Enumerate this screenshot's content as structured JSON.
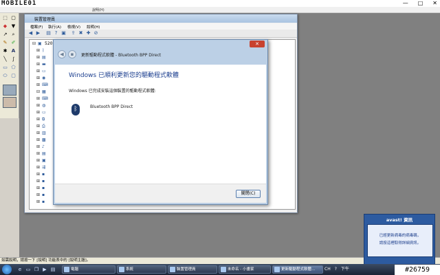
{
  "paint": {
    "title": "未命名 - 小畫家",
    "logo_text": "MOBILE01",
    "help_menu": "說明(H)",
    "controls": {
      "minimize": "—",
      "maximize": "□",
      "close": "✕"
    },
    "status_text": "如需說明，請按一下 [說明] 功能表中的 [說明主題]。"
  },
  "device_manager": {
    "title": "裝置管理員",
    "menu": {
      "file": "檔案(F)",
      "action": "執行(A)",
      "view": "檢視(V)",
      "help": "說明(H)"
    },
    "root_label": "5201"
  },
  "wizard": {
    "title": "更新驅動程式軟體 - Bluetooth BPP Direct",
    "heading": "Windows 已順利更新您的驅動程式軟體",
    "info": "Windows 已完成安裝這個裝置的驅動程式軟體:",
    "device_name": "Bluetooth BPP Direct",
    "close_button": "關閉(C)",
    "close_x": "✕"
  },
  "avast": {
    "title": "avast! 資訊",
    "line1": "已經更新病毒的病毒碼，",
    "line2": "請按這裡取得詳細資訊。"
  },
  "taskbar": {
    "tasks": [
      {
        "label": "電腦",
        "active": false
      },
      {
        "label": "系統",
        "active": false
      },
      {
        "label": "裝置管理員",
        "active": false
      },
      {
        "label": "未命名 - 小畫家",
        "active": false
      },
      {
        "label": "更新驅動程式軟體...",
        "active": true
      }
    ],
    "tray": {
      "lang": "CH",
      "time": "下午"
    }
  },
  "watermark": "#26759",
  "colors": {
    "accent": "#1c3f8f",
    "titlebar": "#bcd0e6",
    "taskbar": "#1b2436"
  }
}
